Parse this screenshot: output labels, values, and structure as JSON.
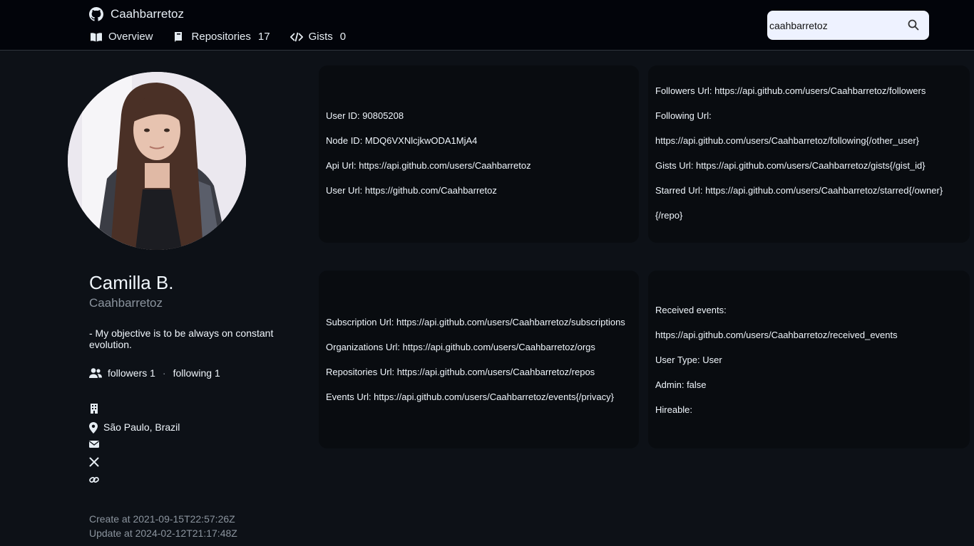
{
  "header": {
    "brand_name": "Caahbarretoz",
    "nav": [
      {
        "label": "Overview",
        "count": ""
      },
      {
        "label": "Repositories",
        "count": "17"
      },
      {
        "label": "Gists",
        "count": "0"
      }
    ],
    "search_value": "caahbarretoz"
  },
  "profile": {
    "name": "Camilla B.",
    "login": "Caahbarretoz",
    "bio": "- My objective is to be always on constant evolution.",
    "followers": "followers 1",
    "separator": "·",
    "following": "following 1",
    "company": "",
    "location": "São Paulo, Brazil",
    "email": "",
    "twitter": "",
    "blog": "",
    "created": "Create at 2021-09-15T22:57:26Z",
    "updated": "Update at 2024-02-12T21:17:48Z"
  },
  "cards": {
    "ids": [
      "User ID: 90805208",
      "Node ID: MDQ6VXNlcjkwODA1MjA4",
      "Api Url: https://api.github.com/users/Caahbarretoz",
      "User Url: https://github.com/Caahbarretoz"
    ],
    "social": [
      "Followers Url: https://api.github.com/users/Caahbarretoz/followers",
      "Following Url:",
      "https://api.github.com/users/Caahbarretoz/following{/other_user}",
      "Gists Url: https://api.github.com/users/Caahbarretoz/gists{/gist_id}",
      "Starred Url: https://api.github.com/users/Caahbarretoz/starred{/owner}",
      "{/repo}"
    ],
    "urls": [
      "Subscription Url: https://api.github.com/users/Caahbarretoz/subscriptions",
      "Organizations Url: https://api.github.com/users/Caahbarretoz/orgs",
      "Repositories Url: https://api.github.com/users/Caahbarretoz/repos",
      "Events Url: https://api.github.com/users/Caahbarretoz/events{/privacy}"
    ],
    "misc": [
      "Received events:",
      "https://api.github.com/users/Caahbarretoz/received_events",
      "User Type: User",
      "Admin: false",
      "Hireable:"
    ]
  },
  "icons": {
    "brand": "github-icon",
    "overview": "book-open-icon",
    "repositories": "book-icon",
    "gists": "code-icon",
    "search": "search-icon",
    "followers": "people-icon",
    "company": "building-icon",
    "location": "location-pin-icon",
    "email": "envelope-icon",
    "twitter": "x-icon",
    "blog": "link-icon"
  },
  "colors": {
    "background": "#0d1117",
    "header": "#02040a",
    "card": "#090c10",
    "muted_text": "#8b949e",
    "search_bg": "#eef2ff"
  }
}
